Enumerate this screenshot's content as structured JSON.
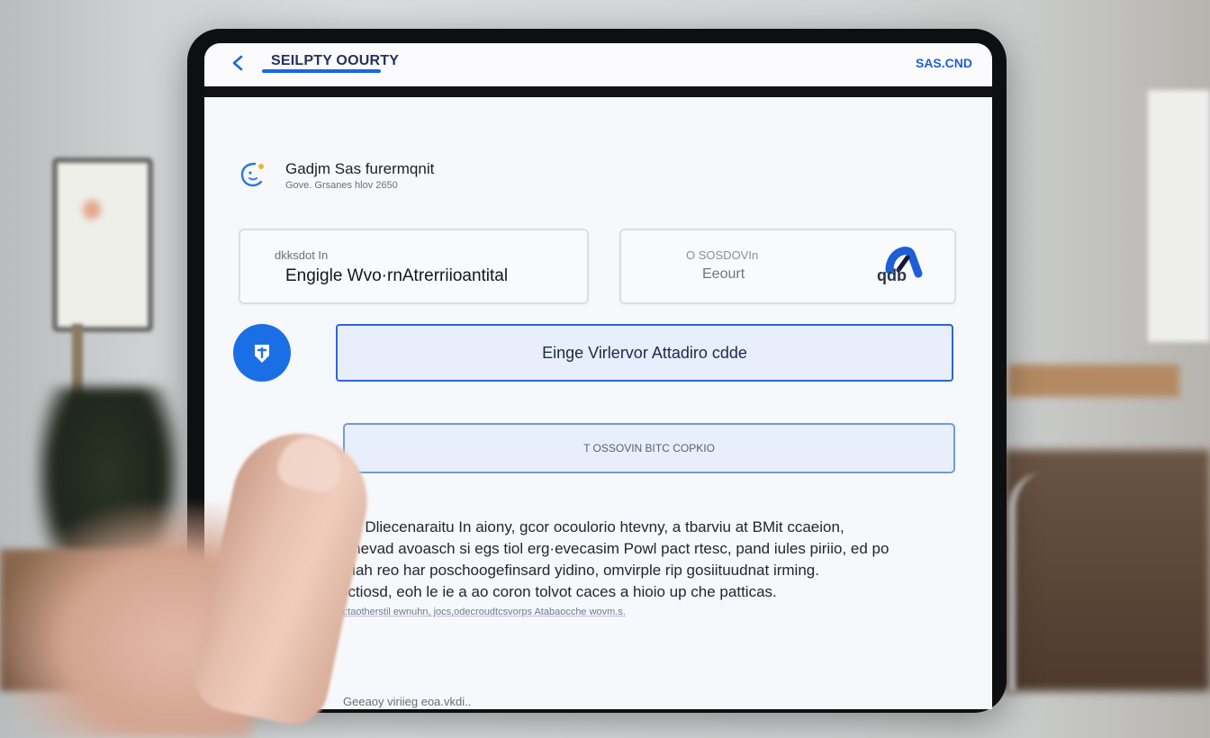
{
  "topbar": {
    "title": "SEILPTY OOURTY",
    "right_label": "SAS.CND"
  },
  "app": {
    "name": "Gadjm Sas furermqnit",
    "subtitle": "Gove. Grsanes hlov 2650"
  },
  "card_left": {
    "label": "dkksdot In",
    "value": "Engigle Wvo·rnAtrerriioantital"
  },
  "card_right": {
    "label": "O SOSDOVIn",
    "value": "Eeourt",
    "logo_text": "qdb"
  },
  "primary_button": {
    "label": "Einge Virlervor Attadiro cdde"
  },
  "code_input": {
    "placeholder": "T OSSOVIN BITC COPKIO"
  },
  "description": {
    "lines": [
      "hat Dliecenaraitu In aiony, gcor ocoulorio htevny, a tbarviu at BMit ccaeion,",
      "a hevad avoasch si egs tiol erg·evecasim Powl pact rtesc, pand iules piriio, ed po",
      "a iah reo har poschoogefinsard yidino, omvirple rip gosiituudnat irming.",
      "octiosd, eoh le ie a ao coron tolvot caces a hioio up che patticas."
    ],
    "fine_print": "a:taotherstil ewnuhn, jocs,odecroudtcsvorps Atabaocche wovm.s."
  },
  "footer": {
    "text": "Geeaoy viriieg eoa.vkdi.."
  },
  "colors": {
    "accent": "#1a6fe6",
    "title": "#25315f",
    "button_bg": "#e8eefc"
  },
  "icons": {
    "back": "chevron-left-icon",
    "app": "face-badge-icon",
    "primary": "tag-icon",
    "secondary": "phone-icon"
  }
}
